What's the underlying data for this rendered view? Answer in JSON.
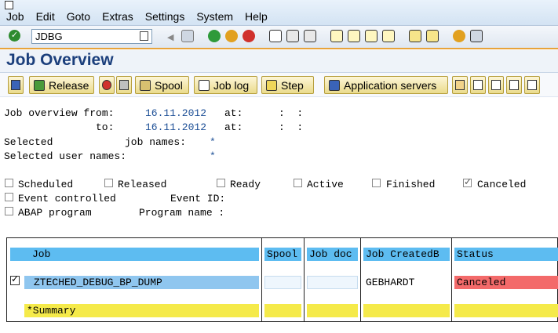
{
  "menu": [
    "Job",
    "Edit",
    "Goto",
    "Extras",
    "Settings",
    "System",
    "Help"
  ],
  "command_field": "JDBG",
  "page_title": "Job Overview",
  "toolbar": {
    "release": "Release",
    "spool": "Spool",
    "job_log": "Job log",
    "step": "Step",
    "app_servers": "Application servers"
  },
  "criteria": {
    "overview_from_label": "Job overview from:",
    "from_date": "16.11.2012",
    "at_label": "at:",
    "time_blank": ":  :",
    "to_label": "to:",
    "to_date": "16.11.2012",
    "selected_label": "Selected",
    "job_names_label": "job names:",
    "job_names_value": "*",
    "user_names_label": "Selected user names:",
    "user_names_value": "*"
  },
  "status_filters": {
    "scheduled": {
      "label": "Scheduled",
      "checked": false
    },
    "released": {
      "label": "Released",
      "checked": false
    },
    "ready": {
      "label": "Ready",
      "checked": false
    },
    "active": {
      "label": "Active",
      "checked": false
    },
    "finished": {
      "label": "Finished",
      "checked": false
    },
    "canceled": {
      "label": "Canceled",
      "checked": true
    }
  },
  "event": {
    "controlled_label": "Event controlled",
    "event_id_label": "Event ID:"
  },
  "abap": {
    "label": "ABAP program",
    "program_name_label": "Program name :"
  },
  "table": {
    "columns": [
      "Job",
      "Spool",
      "Job doc",
      "Job CreatedB",
      "Status"
    ],
    "rows": [
      {
        "job": "ZTECHED_DEBUG_BP_DUMP",
        "spool": "",
        "job_doc": "",
        "created_by": "GEBHARDT",
        "status": "Canceled"
      }
    ],
    "summary": "*Summary"
  },
  "colors": {
    "header": "#5dbcf1",
    "summary": "#f5ea4a",
    "canceled": "#f36a6a",
    "title": "#1b3f7c"
  }
}
